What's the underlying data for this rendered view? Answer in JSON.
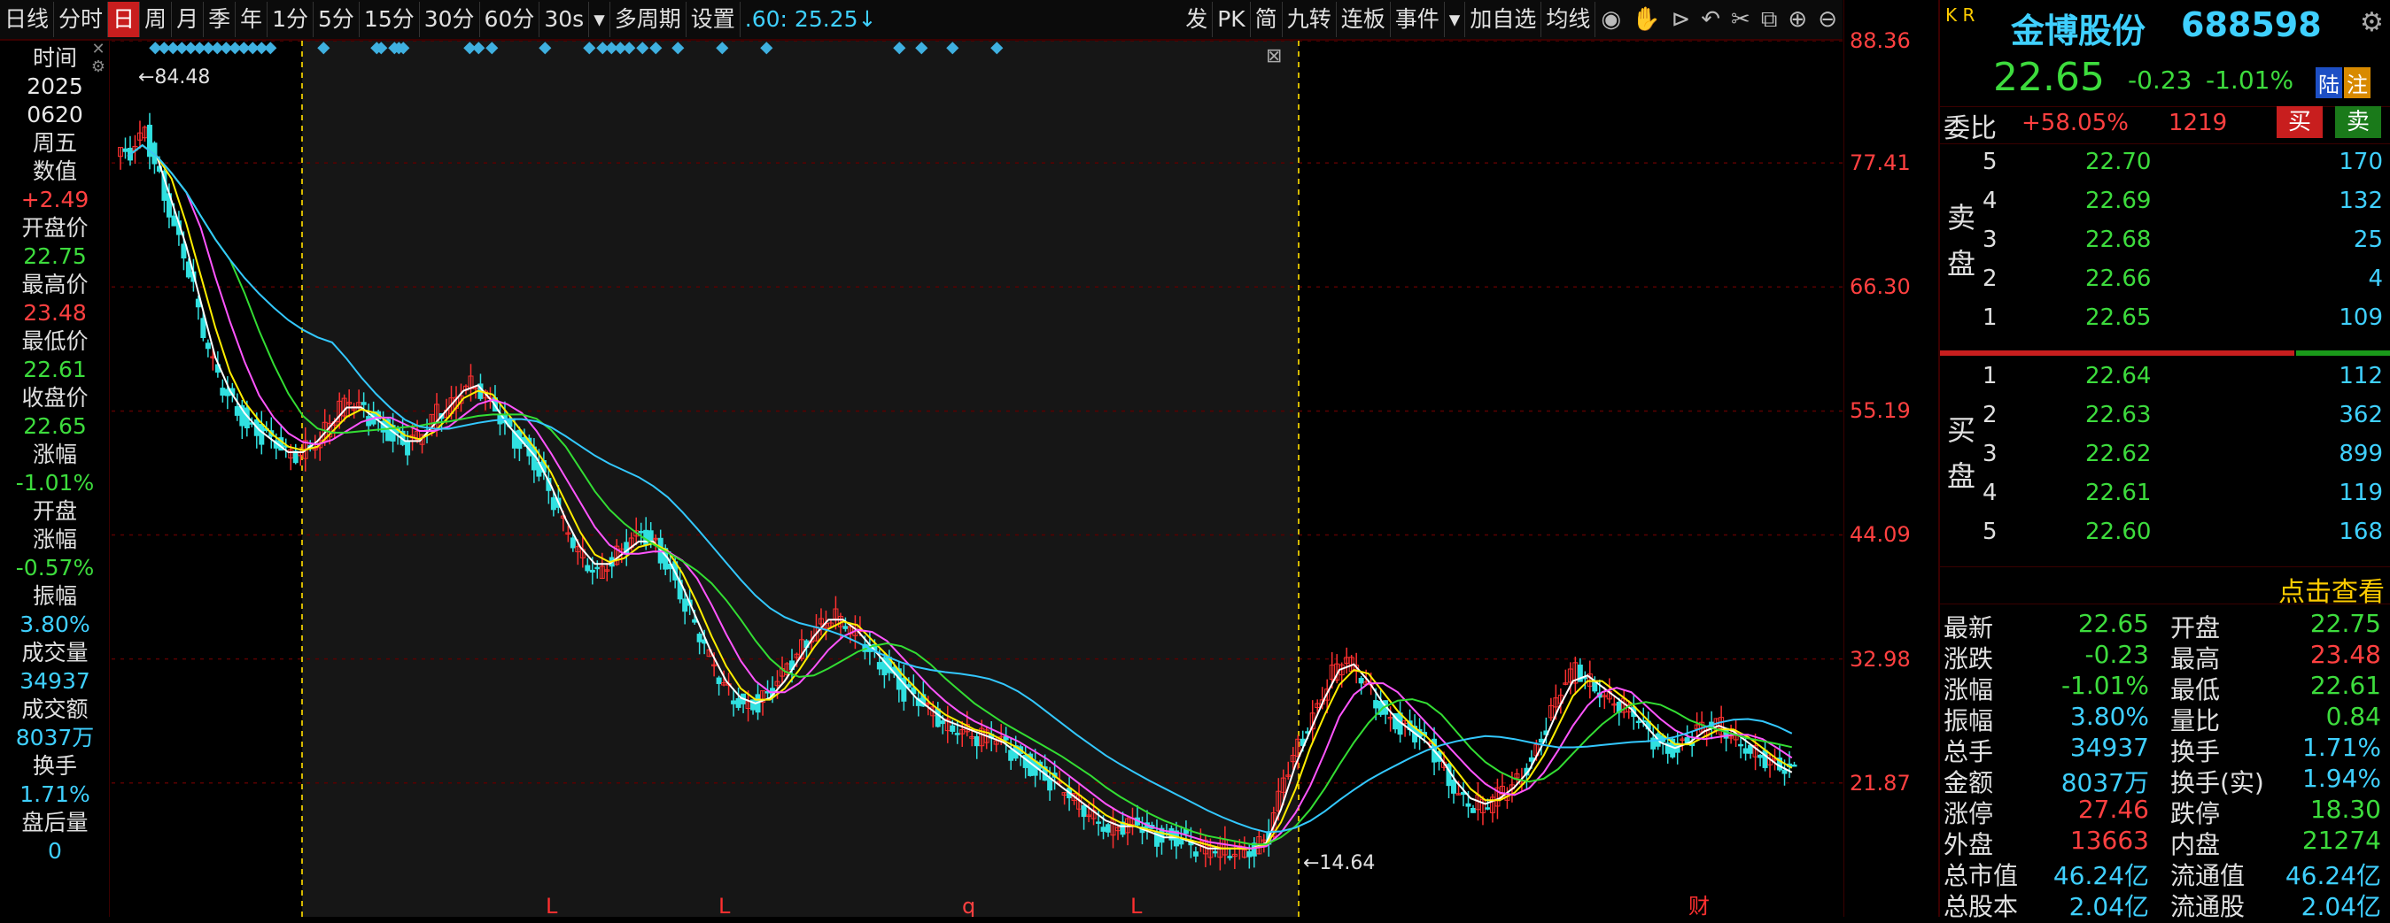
{
  "toolbar": {
    "items": [
      "日线",
      "分时",
      "日",
      "周",
      "月",
      "季",
      "年",
      "1分",
      "5分",
      "15分",
      "30分",
      "60分",
      "30s",
      "多周期",
      "设置"
    ],
    "active": "日",
    "ma_note": ".60: 25.25↓",
    "right_items": [
      "发",
      "PK",
      "简",
      "九转",
      "连板",
      "事件",
      "加自选",
      "均线"
    ]
  },
  "info": {
    "date_label": "时间",
    "year": "2025",
    "date": "0620",
    "weekday": "周五",
    "value_label": "数值",
    "value": "+2.49",
    "open_label": "开盘价",
    "open": "22.75",
    "high_label": "最高价",
    "high": "23.48",
    "low_label": "最低价",
    "low": "22.61",
    "close_label": "收盘价",
    "close": "22.65",
    "chg_label": "涨幅",
    "chg": "-1.01%",
    "open_chg_label1": "开盘",
    "open_chg_label2": "涨幅",
    "open_chg": "-0.57%",
    "amp_label": "振幅",
    "amp": "3.80%",
    "vol_label": "成交量",
    "vol": "34937",
    "amt_label": "成交额",
    "amt": "8037万",
    "turn_label": "换手",
    "turn": "1.71%",
    "after_label": "盘后量",
    "after": "0"
  },
  "chart_data": {
    "type": "candlestick",
    "ylim": [
      14.64,
      88.36
    ],
    "y_ticks": [
      "88.36",
      "77.41",
      "66.30",
      "55.19",
      "44.09",
      "32.98",
      "21.87"
    ],
    "max_label": "84.48",
    "min_label": "14.64",
    "markers_bottom": [
      "L",
      "L",
      "q",
      "L",
      "财"
    ],
    "close_points": [
      78,
      80,
      76,
      72,
      68,
      62,
      58,
      56,
      54,
      53,
      52,
      51,
      52,
      53,
      55,
      56,
      55,
      54,
      53,
      52,
      53,
      55,
      56,
      58,
      57,
      55,
      53,
      52,
      50,
      47,
      44,
      42,
      41,
      42,
      43,
      44,
      43,
      41,
      38,
      35,
      32,
      30,
      29,
      29,
      30,
      32,
      34,
      36,
      37,
      36,
      35,
      33,
      32,
      30,
      29,
      28,
      27,
      27,
      26,
      26,
      25,
      24,
      23,
      22,
      21,
      20,
      19,
      18,
      18,
      18,
      17,
      17,
      17,
      16,
      16,
      16,
      16,
      16,
      17,
      22,
      25,
      28,
      31,
      33,
      32,
      30,
      28,
      27,
      26,
      25,
      23,
      21,
      20,
      20,
      21,
      22,
      24,
      27,
      30,
      32,
      31,
      30,
      29,
      28,
      26,
      25,
      25,
      26,
      27,
      27,
      26,
      25,
      24,
      23,
      22.65
    ]
  },
  "stock": {
    "kr": "K R",
    "name": "金博股份",
    "code": "688598",
    "price": "22.65",
    "change": "-0.23",
    "change_pct": "-1.01%",
    "tag1": "陆",
    "tag2": "注",
    "weibi_label": "委比",
    "weibi": "+58.05%",
    "weicha": "1219",
    "buy_btn": "买",
    "sell_btn": "卖"
  },
  "orderbook": {
    "sell_label": "卖盘",
    "buy_label": "买盘",
    "sells": [
      {
        "lvl": "5",
        "price": "22.70",
        "vol": "170"
      },
      {
        "lvl": "4",
        "price": "22.69",
        "vol": "132"
      },
      {
        "lvl": "3",
        "price": "22.68",
        "vol": "25"
      },
      {
        "lvl": "2",
        "price": "22.66",
        "vol": "4"
      },
      {
        "lvl": "1",
        "price": "22.65",
        "vol": "109"
      }
    ],
    "buys": [
      {
        "lvl": "1",
        "price": "22.64",
        "vol": "112"
      },
      {
        "lvl": "2",
        "price": "22.63",
        "vol": "362"
      },
      {
        "lvl": "3",
        "price": "22.62",
        "vol": "899"
      },
      {
        "lvl": "4",
        "price": "22.61",
        "vol": "119"
      },
      {
        "lvl": "5",
        "price": "22.60",
        "vol": "168"
      }
    ],
    "click_more": "点击查看"
  },
  "quote": [
    {
      "k1": "最新",
      "v1": "22.65",
      "c1": "green",
      "k2": "开盘",
      "v2": "22.75",
      "c2": "green"
    },
    {
      "k1": "涨跌",
      "v1": "-0.23",
      "c1": "green",
      "k2": "最高",
      "v2": "23.48",
      "c2": "red"
    },
    {
      "k1": "涨幅",
      "v1": "-1.01%",
      "c1": "green",
      "k2": "最低",
      "v2": "22.61",
      "c2": "green"
    },
    {
      "k1": "振幅",
      "v1": "3.80%",
      "c1": "cyan",
      "k2": "量比",
      "v2": "0.84",
      "c2": "green"
    },
    {
      "k1": "总手",
      "v1": "34937",
      "c1": "cyan",
      "k2": "换手",
      "v2": "1.71%",
      "c2": "cyan"
    },
    {
      "k1": "金额",
      "v1": "8037万",
      "c1": "cyan",
      "k2": "换手(实)",
      "v2": "1.94%",
      "c2": "cyan"
    },
    {
      "k1": "涨停",
      "v1": "27.46",
      "c1": "red",
      "k2": "跌停",
      "v2": "18.30",
      "c2": "green"
    },
    {
      "k1": "外盘",
      "v1": "13663",
      "c1": "red",
      "k2": "内盘",
      "v2": "21274",
      "c2": "green"
    },
    {
      "k1": "总市值",
      "v1": "46.24亿",
      "c1": "cyan",
      "k2": "流通值",
      "v2": "46.24亿",
      "c2": "cyan"
    },
    {
      "k1": "总股本",
      "v1": "2.04亿",
      "c1": "cyan",
      "k2": "流通股",
      "v2": "2.04亿",
      "c2": "cyan"
    }
  ]
}
